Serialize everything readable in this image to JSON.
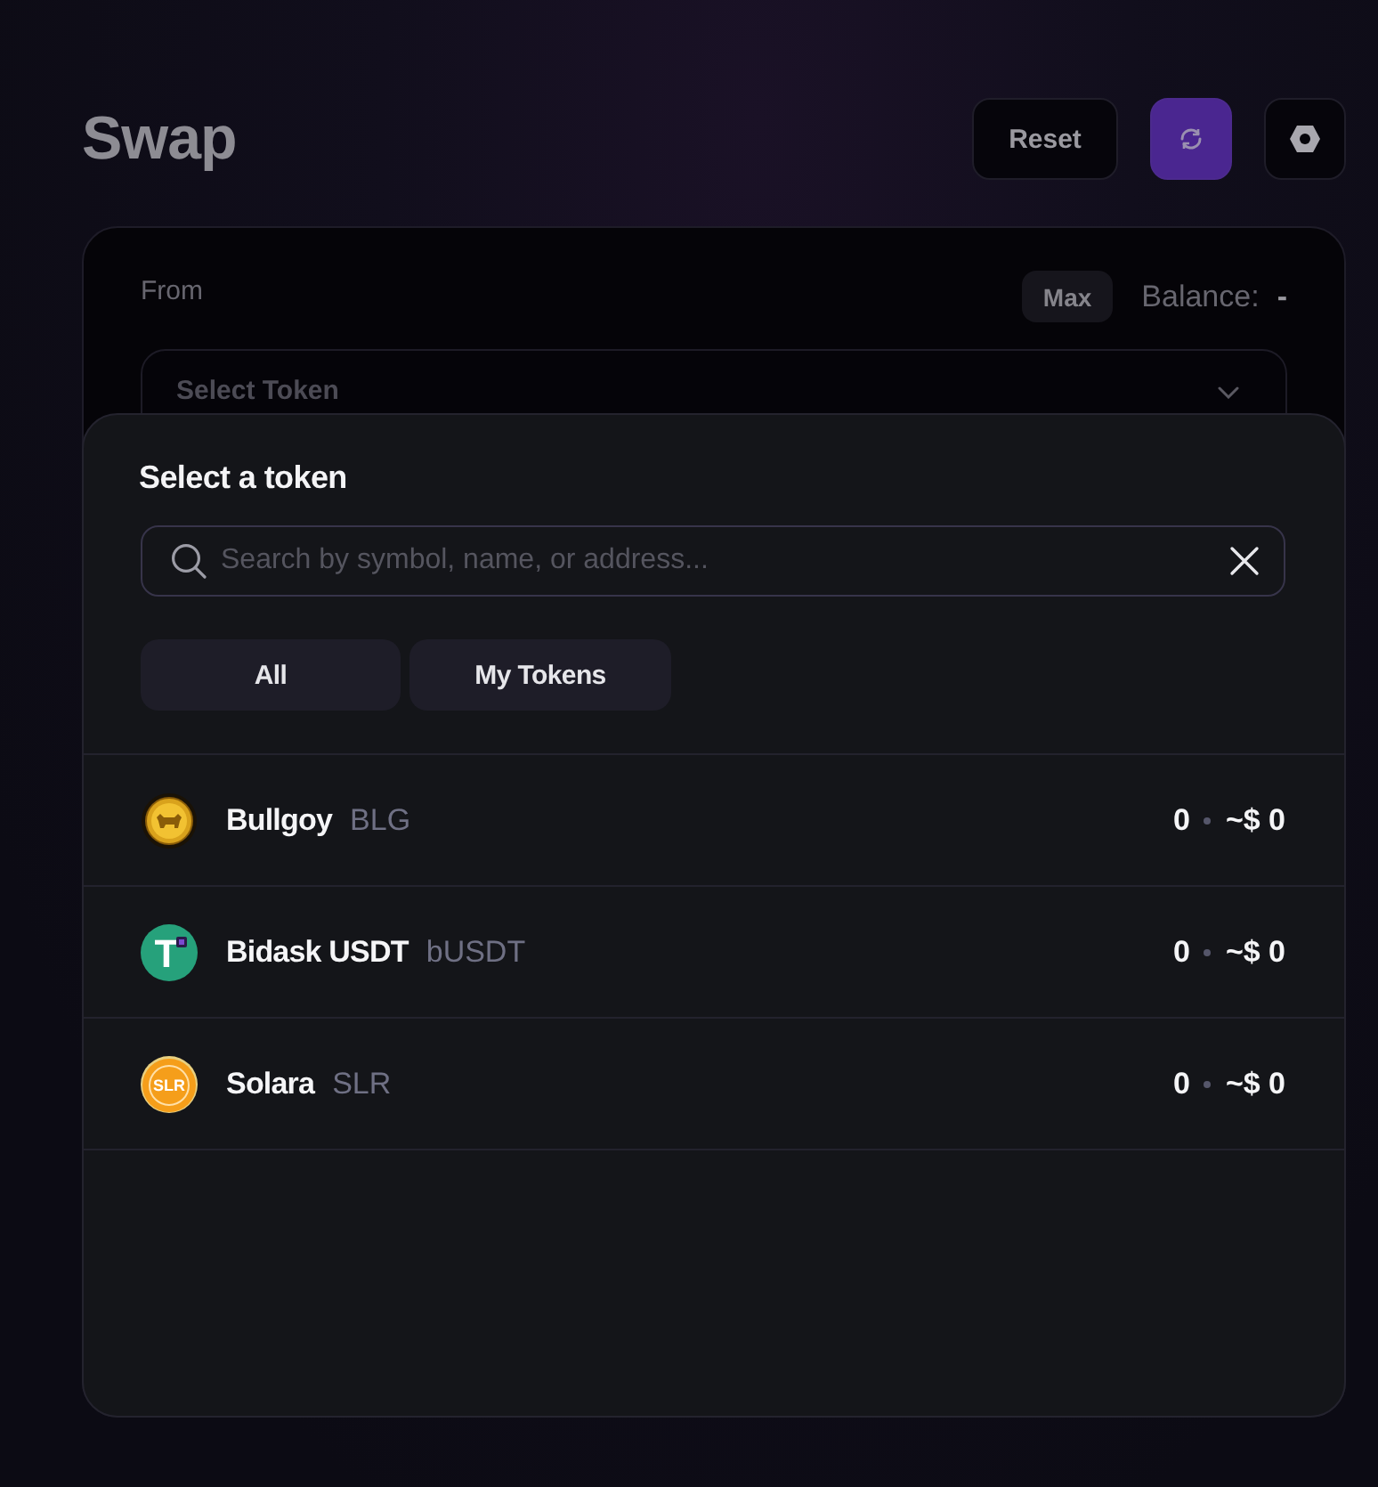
{
  "header": {
    "title": "Swap",
    "buttons": [
      {
        "kind": "text",
        "label": "Reset"
      },
      {
        "kind": "refresh"
      },
      {
        "kind": "settings"
      }
    ]
  },
  "swap_card": {
    "from_label": "From",
    "max_button": "Max",
    "balance_label": "Balance:",
    "balance_value": "-",
    "token_select": {
      "placeholder": "Select Token"
    }
  },
  "token_modal": {
    "title": "Select a token",
    "search": {
      "placeholder": "Search by symbol, name, or address..."
    },
    "tabs": [
      {
        "label": "All"
      },
      {
        "label": "My Tokens"
      }
    ],
    "tokens": [
      {
        "name": "Bullgoy",
        "symbol": "BLG",
        "amount": "0",
        "value": "~$ 0",
        "kind": "bull"
      },
      {
        "name": "Bidask USDT",
        "symbol": "bUSDT",
        "amount": "0",
        "value": "~$ 0",
        "kind": "tether",
        "logo_text": "T"
      },
      {
        "name": "Solara",
        "symbol": "SLR",
        "amount": "0",
        "value": "~$ 0",
        "kind": "solara",
        "logo_text": "SLR"
      }
    ]
  }
}
